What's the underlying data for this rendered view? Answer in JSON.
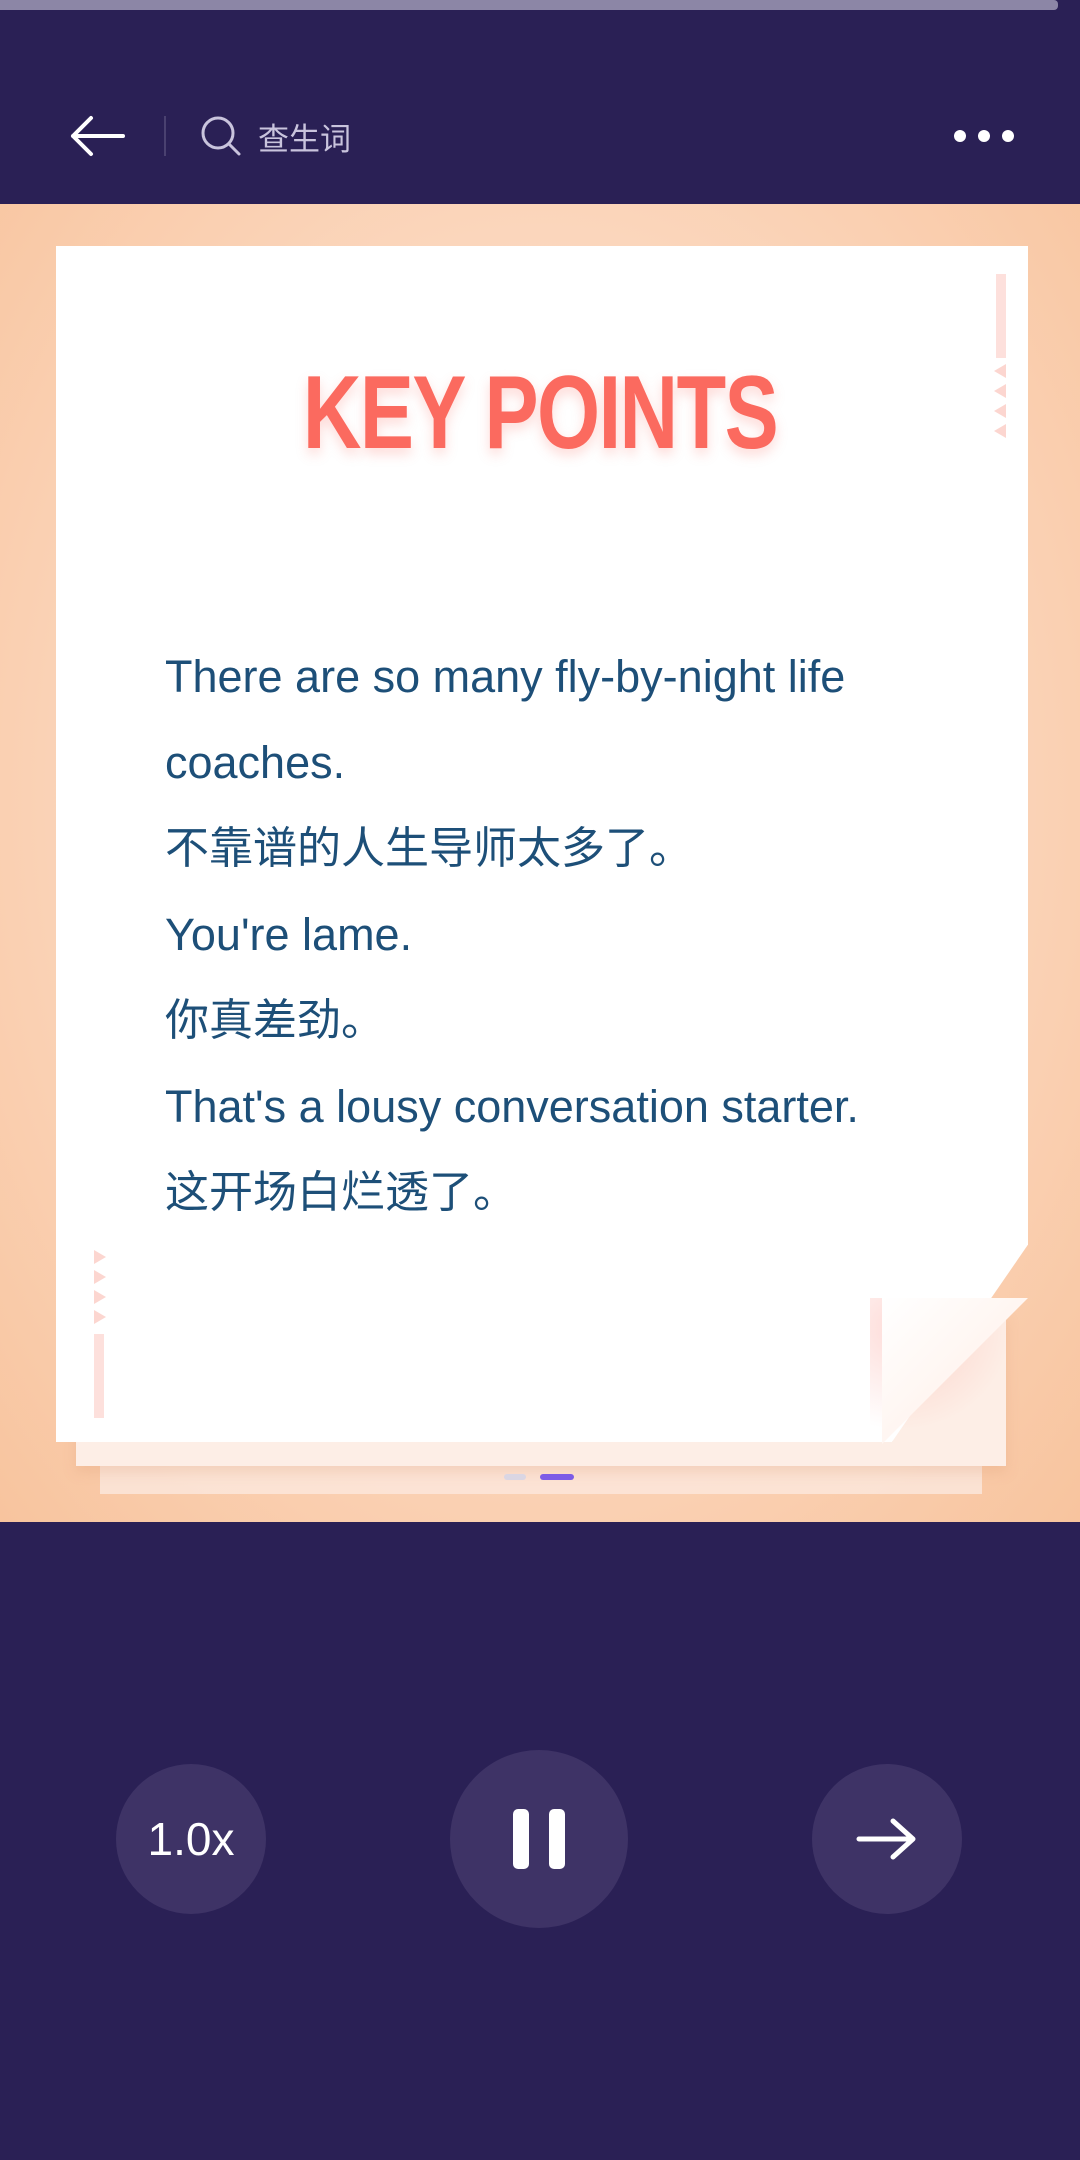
{
  "playback": {
    "progress": 0.98
  },
  "header": {
    "back_icon": "arrow-left-icon",
    "search_icon": "search-icon",
    "search_label": "查生词",
    "more_icon": "more-horizontal-icon"
  },
  "card": {
    "title": "KEY POINTS",
    "lines": [
      {
        "lang": "en",
        "text": "There are so many fly-by-night life coaches."
      },
      {
        "lang": "zh",
        "text": "不靠谱的人生导师太多了。"
      },
      {
        "lang": "en",
        "text": "You're lame."
      },
      {
        "lang": "zh",
        "text": "你真差劲。"
      },
      {
        "lang": "en",
        "text": "That's a lousy conversation starter."
      },
      {
        "lang": "zh",
        "text": "这开场白烂透了。"
      }
    ]
  },
  "pager": {
    "current": 2,
    "total": 2
  },
  "controls": {
    "speed_label": "1.0x",
    "play_icon": "pause-icon",
    "next_icon": "arrow-right-icon"
  },
  "colors": {
    "background": "#2a2055",
    "button": "#3e3366",
    "title": "#fb6a5f",
    "text": "#1d4f78",
    "accent": "#7c5ce6"
  }
}
